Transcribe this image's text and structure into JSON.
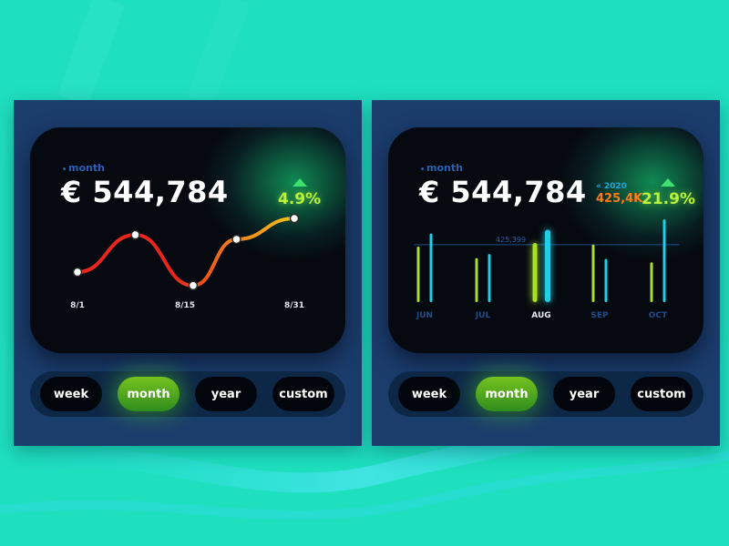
{
  "panels": [
    {
      "period_tag": "month",
      "amount": "€ 544,784",
      "change": "4.9%",
      "tabs": [
        "week",
        "month",
        "year",
        "custom"
      ],
      "active_tab": "month",
      "chart_data": {
        "type": "line",
        "x_tick_labels": [
          "8/1",
          "8/15",
          "8/31"
        ],
        "points": [
          {
            "x": 1,
            "y": 0.28
          },
          {
            "x": 9,
            "y": 0.78
          },
          {
            "x": 17,
            "y": 0.1
          },
          {
            "x": 23,
            "y": 0.72
          },
          {
            "x": 31,
            "y": 1.0
          }
        ],
        "colors": {
          "low": "#e8261e",
          "mid": "#f07a1a",
          "high": "#f2c21a",
          "marker_fill": "#ffffff"
        },
        "grid": false
      }
    },
    {
      "period_tag": "month",
      "amount": "€ 544,784",
      "change": "21.9%",
      "compare": {
        "year": "2020",
        "value": "425,4K"
      },
      "tabs": [
        "week",
        "month",
        "year",
        "custom"
      ],
      "active_tab": "month",
      "chart_data": {
        "type": "bar",
        "categories": [
          "JUN",
          "JUL",
          "AUG",
          "SEP",
          "OCT"
        ],
        "selected": "AUG",
        "reference_line": {
          "label": "425,399",
          "value": 425399
        },
        "series": [
          {
            "values": [
              412000,
              326000,
              438000,
              426000,
              295000
            ],
            "color": "#a8e02a"
          },
          {
            "values": [
              508000,
              356000,
              536000,
              320000,
              612000
            ],
            "color": "#1fd0e8"
          }
        ]
      }
    }
  ]
}
